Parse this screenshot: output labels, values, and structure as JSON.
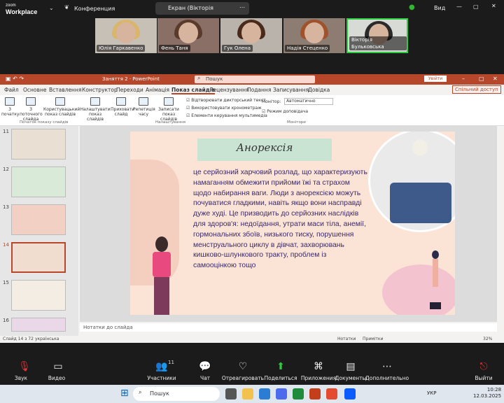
{
  "zoom": {
    "logo_top": "zoom",
    "logo_bottom": "Workplace",
    "meeting": "Конференция",
    "share": "Екран (Вікторія Бульковська)",
    "view": "Вид"
  },
  "participants": [
    {
      "name": "Юлія Гаркавенко"
    },
    {
      "name": "Фень Таня"
    },
    {
      "name": "Гук Олена"
    },
    {
      "name": "Надія Стеценко"
    },
    {
      "name": "Вікторія Бульковська"
    }
  ],
  "ppt": {
    "title": "Заняття 2 · PowerPoint",
    "search": "Пошук",
    "signin": "Увійти",
    "menu": [
      "Файл",
      "Основне",
      "Вставлення",
      "Конструктор",
      "Переходи",
      "Анімація",
      "Показ слайдів",
      "Рецензування",
      "Подання",
      "Записування",
      "Довідка"
    ],
    "share": "Спільний доступ",
    "ribbon": {
      "from_start": "З початку",
      "from_current": "З поточного слайда",
      "custom": "Користувацький показ слайдів",
      "rehearse": "Налаштувати показ слайдів",
      "hide": "Приховати слайд",
      "rehearse_timing": "Репетиція часу",
      "record": "Записати показ слайдів",
      "chk1": "Відтворювати дикторський текст",
      "chk2": "Використовувати хронометраж",
      "chk3": "Елементи керування мультимедіа",
      "monitor_label": "Монітор:",
      "monitor_val": "Автоматично",
      "presenter": "Режим доповідача",
      "grp1": "Початок показу слайдів",
      "grp2": "Налаштування",
      "grp3": "Монітори"
    },
    "thumbs": [
      "11",
      "12",
      "13",
      "14",
      "15",
      "16"
    ],
    "slide": {
      "title": "Анорексія",
      "body": "це серйозний харчовий розлад, що характеризують намаганням обмежити прийоми їжі та страхом щодо набирання ваги. Люди з анорексією можуть почуватися гладкими, навіть якщо вони насправді дуже худі. Це призводить до серйозних наслідків для здоров'я: недоїдання, утрати маси тіла, анемії, гормональних збоїв, низького тиску, порушення менструального циклу в дівчат, захворювань кишково-шлункового тракту, проблем із самооцінкою тощо"
    },
    "notes": "Нотатки до слайда",
    "status": {
      "slide": "Слайд 14 з 72",
      "lang": "українська",
      "notes": "Нотатки",
      "comments": "Примітки",
      "zoom": "32%"
    }
  },
  "bottom": {
    "audio": "Звук",
    "video": "Видео",
    "participants": "Участники",
    "pcount": "11",
    "chat": "Чат",
    "react": "Отреагировать",
    "share": "Поделиться",
    "apps": "Приложения",
    "docs": "Документы",
    "more": "Дополнительно",
    "leave": "Выйти"
  },
  "taskbar": {
    "search": "Пошук",
    "lang": "УКР",
    "time": "10:28",
    "date": "12.03.2025"
  }
}
